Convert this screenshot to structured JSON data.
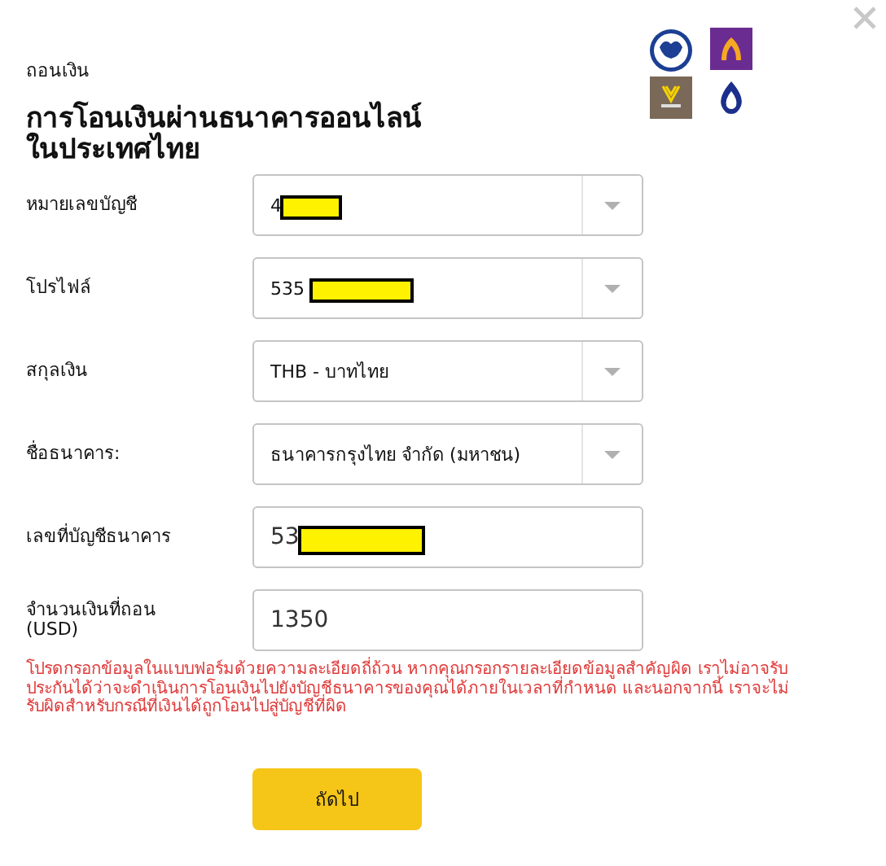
{
  "header": {
    "subtitle": "ถอนเงิน",
    "title": "การโอนเงินผ่านธนาคารออนไลน์\nในประเทศไทย"
  },
  "fields": [
    {
      "kind": "select",
      "label": "หมายเลขบัญชี",
      "value": "4",
      "redacted": true
    },
    {
      "kind": "select",
      "label": "โปรไฟล์",
      "value": "535",
      "redacted": true
    },
    {
      "kind": "select",
      "label": "สกุลเงิน",
      "value": "THB - บาทไทย",
      "redacted": false
    },
    {
      "kind": "select",
      "label": "ชื่อธนาคาร:",
      "value": "ธนาคารกรุงไทย จำกัด (มหาชน)",
      "redacted": false
    },
    {
      "kind": "input",
      "label": "เลขที่บัญชีธนาคาร",
      "value": "53",
      "redacted": true
    },
    {
      "kind": "input",
      "label": "จำนวนเงินที่ถอน\n(USD)",
      "value": "1350",
      "redacted": false
    }
  ],
  "warning": "โปรดกรอกข้อมูลในแบบฟอร์มด้วยความละเอียดถี่ถ้วน หากคุณกรอกรายละเอียดข้อมูลสำคัญผิด เราไม่อาจรับประกันได้ว่าจะดำเนินการโอนเงินไปยังบัญชีธนาคารของคุณได้ภายในเวลาที่กำหนด และนอกจากนี้ เราจะไม่รับผิดสำหรับกรณีที่เงินได้ถูกโอนไปสู่บัญชีที่ผิด",
  "next_button": "ถัดไป"
}
